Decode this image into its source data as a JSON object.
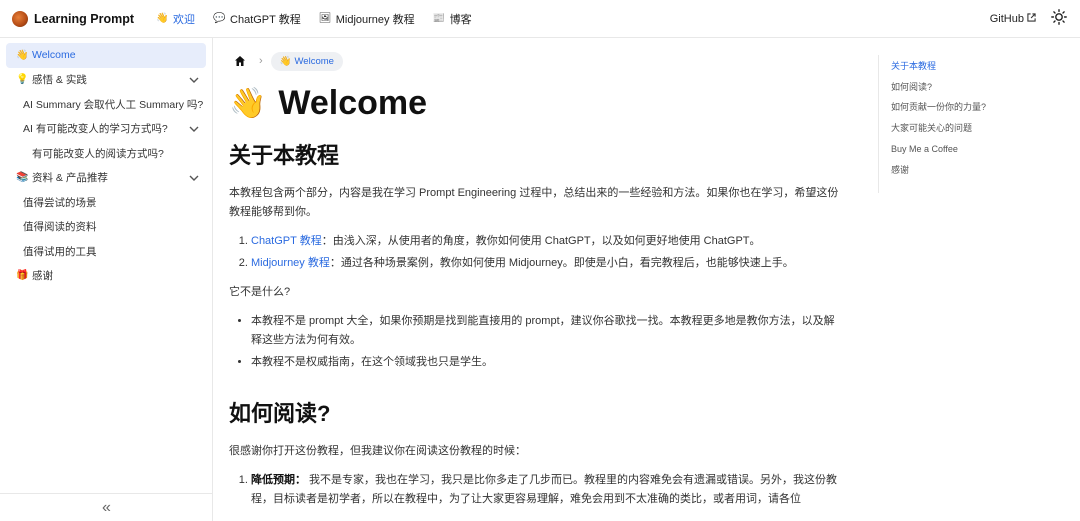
{
  "navbar": {
    "brand": "Learning Prompt",
    "links": [
      {
        "icon": "👋",
        "label": "欢迎"
      },
      {
        "icon": "💬",
        "label": "ChatGPT 教程"
      },
      {
        "icon": "🖼",
        "label": "Midjourney 教程"
      },
      {
        "icon": "📰",
        "label": "博客"
      }
    ],
    "github": "GitHub"
  },
  "sidebar": {
    "items": [
      {
        "icon": "👋",
        "label": "Welcome"
      },
      {
        "icon": "💡",
        "label": "感悟 & 实践"
      },
      {
        "label": "AI Summary 会取代人工 Summary 吗?"
      },
      {
        "label": "AI 有可能改变人的学习方式吗?"
      },
      {
        "label": "有可能改变人的阅读方式吗?"
      },
      {
        "icon": "📚",
        "label": "资料 & 产品推荐"
      },
      {
        "label": "值得尝试的场景"
      },
      {
        "label": "值得阅读的资料"
      },
      {
        "label": "值得试用的工具"
      },
      {
        "icon": "🎁",
        "label": "感谢"
      }
    ],
    "collapse": "«"
  },
  "breadcrumb": {
    "sep": "›",
    "current_icon": "👋",
    "current": "Welcome"
  },
  "page": {
    "title_icon": "👋",
    "title": "Welcome",
    "h_about": "关于本教程",
    "about_p": "本教程包含两个部分，内容是我在学习 Prompt Engineering 过程中，总结出来的一些经验和方法。如果你也在学习，希望这份教程能够帮到你。",
    "ol1": [
      {
        "link": "ChatGPT 教程",
        "text": "：由浅入深，从使用者的角度，教你如何使用 ChatGPT，以及如何更好地使用 ChatGPT。"
      },
      {
        "link": "Midjourney 教程",
        "text": "：通过各种场景案例，教你如何使用 Midjourney。即使是小白，看完教程后，也能够快速上手。"
      }
    ],
    "not_q": "它不是什么?",
    "ul1": [
      "本教程不是 prompt 大全，如果你预期是找到能直接用的 prompt，建议你谷歌找一找。本教程更多地是教你方法，以及解释这些方法为何有效。",
      "本教程不是权威指南，在这个领域我也只是学生。"
    ],
    "h_read": "如何阅读?",
    "read_p": "很感谢你打开这份教程，但我建议你在阅读这份教程的时候：",
    "ol2": [
      {
        "bold": "降低预期：",
        "text": " 我不是专家，我也在学习，我只是比你多走了几步而已。教程里的内容难免会有遗漏或错误。另外，我这份教程，目标读者是初学者，所以在教程中，为了让大家更容易理解，难免会用到不太准确的类比，或者用词，请各位"
      }
    ]
  },
  "toc": [
    "关于本教程",
    "如何阅读?",
    "如何贡献一份你的力量?",
    "大家可能关心的问题",
    "Buy Me a Coffee",
    "感谢"
  ]
}
